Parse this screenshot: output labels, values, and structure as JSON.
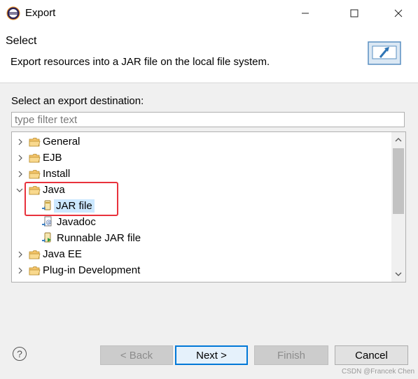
{
  "window": {
    "title": "Export",
    "min_icon": "minimize-icon",
    "max_icon": "maximize-icon",
    "close_icon": "close-icon"
  },
  "header": {
    "title": "Select",
    "description": "Export resources into a JAR file on the local file system."
  },
  "destination": {
    "label": "Select an export destination:",
    "filter_placeholder": "type filter text",
    "filter_value": ""
  },
  "tree": {
    "items": [
      {
        "label": "General",
        "expanded": false,
        "icon": "folder-icon"
      },
      {
        "label": "EJB",
        "expanded": false,
        "icon": "folder-icon"
      },
      {
        "label": "Install",
        "expanded": false,
        "icon": "folder-icon"
      },
      {
        "label": "Java",
        "expanded": true,
        "icon": "folder-icon"
      },
      {
        "label": "JAR file",
        "selected": true,
        "icon": "jar-file-icon"
      },
      {
        "label": "Javadoc",
        "icon": "javadoc-icon"
      },
      {
        "label": "Runnable JAR file",
        "icon": "runnable-jar-icon"
      },
      {
        "label": "Java EE",
        "expanded": false,
        "icon": "folder-icon"
      },
      {
        "label": "Plug-in Development",
        "expanded": false,
        "icon": "folder-icon"
      }
    ]
  },
  "buttons": {
    "back": "< Back",
    "next": "Next >",
    "finish": "Finish",
    "cancel": "Cancel",
    "help": "?"
  },
  "watermark": "CSDN @Francek Chen",
  "colors": {
    "selection": "#cce8ff",
    "highlight_border": "#e8323c",
    "default_button_border": "#0078d7"
  }
}
